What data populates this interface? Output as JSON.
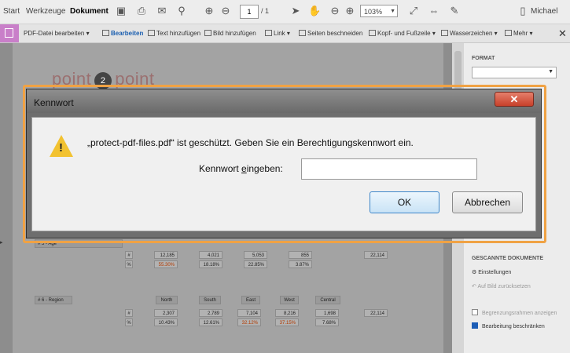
{
  "topbar": {
    "tabs": [
      "Start",
      "Werkzeuge",
      "Dokument"
    ],
    "page_current": "1",
    "page_total": "/ 1",
    "zoom": "103%",
    "user": "Michael"
  },
  "editbar": {
    "items": [
      "PDF-Datei bearbeiten",
      "Bearbeiten",
      "Text hinzufügen",
      "Bild hinzufügen",
      "Link",
      "Seiten beschneiden",
      "Kopf- und Fußzeile",
      "Wasserzeichen",
      "Mehr"
    ]
  },
  "document": {
    "logo_left": "point",
    "logo_mid": "2",
    "logo_right": "point",
    "table1": {
      "row_label": "# 5 - Age",
      "counts": [
        "#",
        "12,185",
        "4,021",
        "5,053",
        "855",
        "22,114"
      ],
      "percents": [
        "%",
        "55.30%",
        "18.18%",
        "22.85%",
        "3.87%"
      ]
    },
    "table2": {
      "title": "# 6 - Region",
      "headers": [
        "North",
        "South",
        "East",
        "West",
        "Central"
      ],
      "counts": [
        "#",
        "2,307",
        "2,789",
        "7,104",
        "8,216",
        "1,698",
        "22,114"
      ],
      "percents": [
        "%",
        "10.43%",
        "12.61%",
        "32.12%",
        "37.15%",
        "7.68%"
      ]
    }
  },
  "rpanel": {
    "format": "FORMAT",
    "scanned": "GESCANNTE DOKUMENTE",
    "settings": "Einstellungen",
    "reset": "Auf Bild zurücksetzen",
    "bounding": "Begrenzungsrahmen anzeigen",
    "restrict": "Bearbeitung beschränken"
  },
  "dialog": {
    "title": "Kennwort",
    "close": "✕",
    "message": "„protect-pdf-files.pdf“ ist geschützt. Geben Sie ein Berechtigungskennwort ein.",
    "label_pre": "Kennwort ",
    "label_accel": "e",
    "label_post": "ingeben:",
    "password_value": "",
    "ok": "OK",
    "cancel": "Abbrechen"
  }
}
